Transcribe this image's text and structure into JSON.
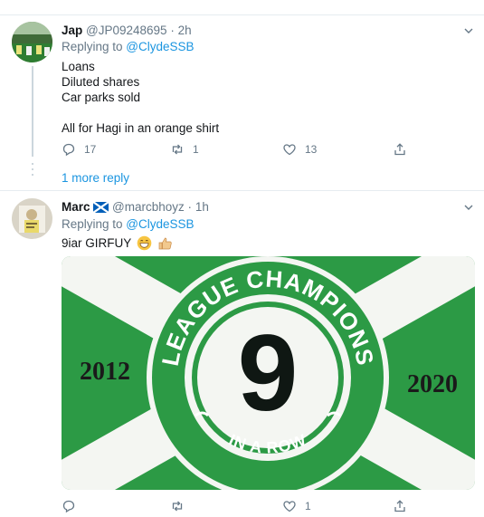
{
  "tweet1": {
    "name": "Jap",
    "handle": "@JP09248695",
    "time": "2h",
    "replying_prefix": "Replying to ",
    "replying_handle": "@ClydeSSB",
    "lines": [
      "Loans",
      "Diluted shares",
      "Car parks sold",
      "All for Hagi in an orange shirt"
    ],
    "reply_count": "17",
    "retweet_count": "1",
    "like_count": "13"
  },
  "thread": {
    "more_replies": "1 more reply"
  },
  "tweet2": {
    "name": "Marc",
    "handle": "@marcbhoyz",
    "time": "1h",
    "replying_prefix": "Replying to ",
    "replying_handle": "@ClydeSSB",
    "text": "9iar GIRFUY",
    "reply_count": "",
    "retweet_count": "",
    "like_count": "1",
    "image": {
      "top_text": "LEAGUE CHAMPIONS",
      "bottom_text": "IN A ROW",
      "number": "9",
      "year_left": "2012",
      "year_right": "2020"
    }
  },
  "colors": {
    "link": "#1b95e0",
    "flag_green": "#2c9a45",
    "muted": "#657786"
  }
}
